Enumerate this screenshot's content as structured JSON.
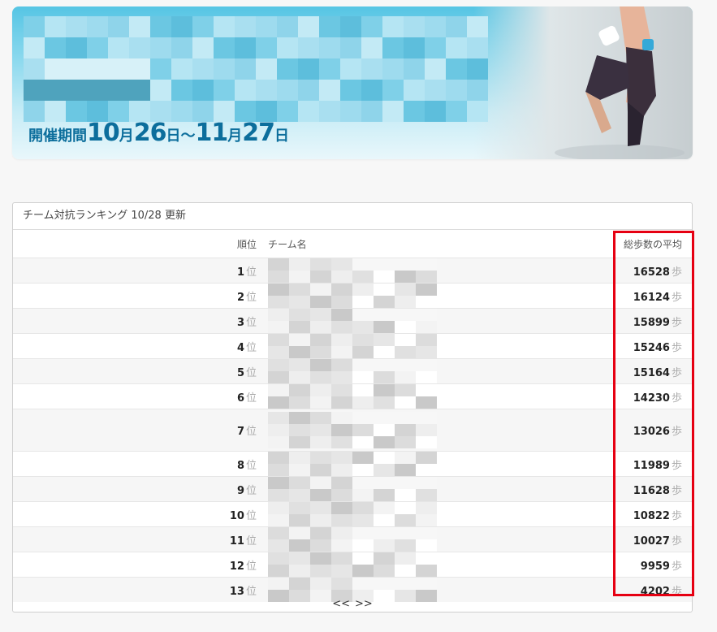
{
  "banner": {
    "period_label": "開催期間",
    "start_month": "10",
    "start_day": "26",
    "end_month": "11",
    "end_day": "27",
    "month_unit": "月",
    "day_unit": "日",
    "range_sep": "〜"
  },
  "ranking": {
    "title": "チーム対抗ランキング 10/28 更新",
    "headers": {
      "rank": "順位",
      "team": "チーム名",
      "avg": "総歩数の平均"
    },
    "rank_suffix": "位",
    "step_unit": "歩",
    "rows": [
      {
        "rank": "1",
        "steps": "16528"
      },
      {
        "rank": "2",
        "steps": "16124"
      },
      {
        "rank": "3",
        "steps": "15899"
      },
      {
        "rank": "4",
        "steps": "15246"
      },
      {
        "rank": "5",
        "steps": "15164"
      },
      {
        "rank": "6",
        "steps": "14230"
      },
      {
        "rank": "7",
        "steps": "13026"
      },
      {
        "rank": "8",
        "steps": "11989"
      },
      {
        "rank": "9",
        "steps": "11628"
      },
      {
        "rank": "10",
        "steps": "10822"
      },
      {
        "rank": "11",
        "steps": "10027"
      },
      {
        "rank": "12",
        "steps": "9959"
      },
      {
        "rank": "13",
        "steps": "4202"
      }
    ],
    "pager": {
      "prev": "<<",
      "next": ">>"
    }
  },
  "colors": {
    "highlight": "#e60012",
    "period_text": "#0c6e9c"
  }
}
